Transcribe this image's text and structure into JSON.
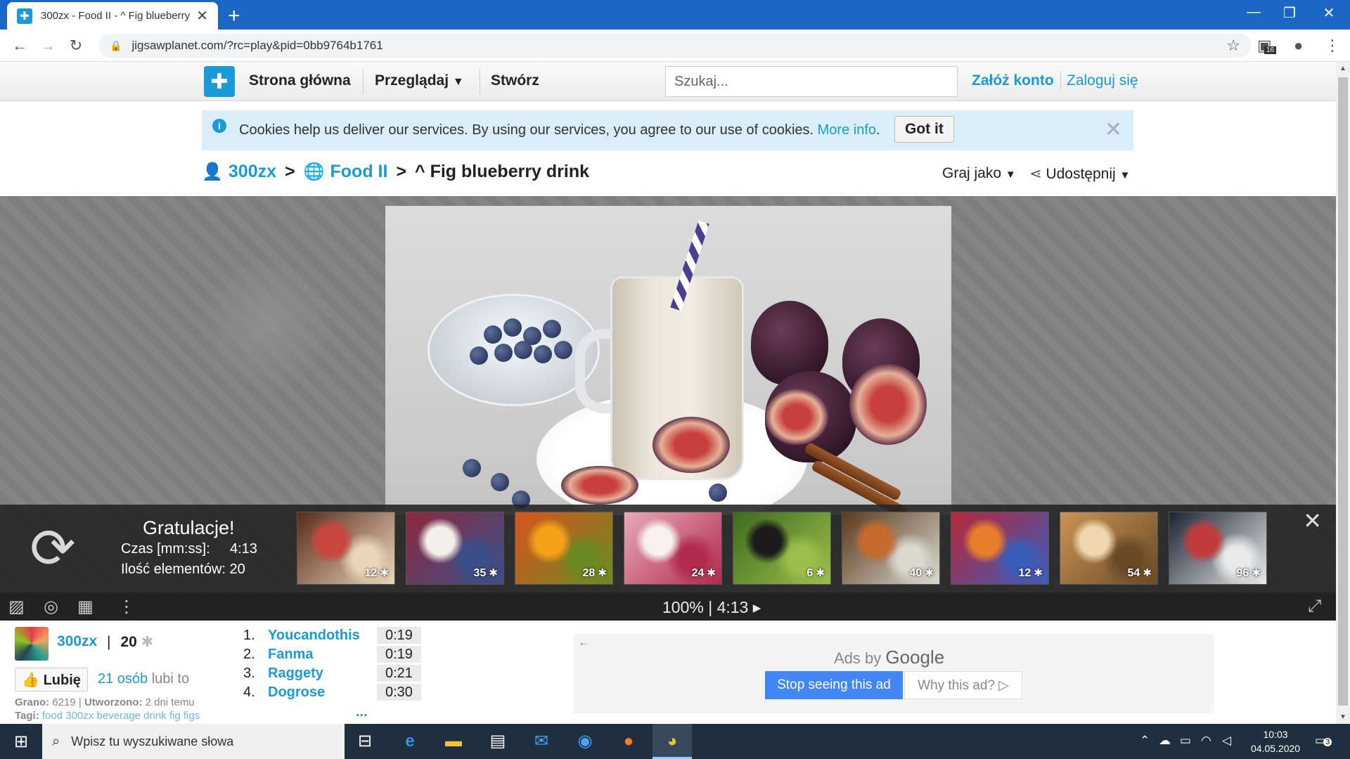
{
  "browser": {
    "tab_title": "300zx - Food II - ^ Fig blueberry",
    "url": "jigsawplanet.com/?rc=play&pid=0bb9764b1761",
    "extension_badge": "16"
  },
  "site": {
    "nav": {
      "home": "Strona główna",
      "browse": "Przeglądaj",
      "create": "Stwórz"
    },
    "search_placeholder": "Szukaj...",
    "register": "Załóż konto",
    "login": "Zaloguj się"
  },
  "cookie": {
    "message": "Cookies help us deliver our services. By using our services, you agree to our use of cookies.",
    "more_info": "More info",
    "got_it": "Got it"
  },
  "breadcrumb": {
    "user": "300zx",
    "sep1": ">",
    "folder": "Food II",
    "sep2": ">",
    "title": "^ Fig blueberry drink"
  },
  "menus": {
    "play_as": "Graj jako",
    "share": "Udostępnij"
  },
  "finish": {
    "congrats": "Gratulacje!",
    "time_label": "Czas [mm:ss]:",
    "time_value": "4:13",
    "pieces_label": "Ilość elementów:",
    "pieces_value": "20",
    "suggestions": [
      {
        "count": "12",
        "colors": [
          "#5a2a1c",
          "#c9463d",
          "#e9d6b8"
        ]
      },
      {
        "count": "35",
        "colors": [
          "#8c2a3e",
          "#f3f0ea",
          "#3a4f8a"
        ]
      },
      {
        "count": "28",
        "colors": [
          "#d9541d",
          "#f3a21a",
          "#6c8a23"
        ]
      },
      {
        "count": "24",
        "colors": [
          "#e7a9b7",
          "#f7f1f2",
          "#b12b4c"
        ]
      },
      {
        "count": "6",
        "colors": [
          "#3e6b1e",
          "#1b1b1b",
          "#9bbf4a"
        ]
      },
      {
        "count": "40",
        "colors": [
          "#5b3a1b",
          "#c76a2d",
          "#d9d9d0"
        ]
      },
      {
        "count": "12",
        "colors": [
          "#b8263a",
          "#e87d2c",
          "#3a5db8"
        ]
      },
      {
        "count": "54",
        "colors": [
          "#c99455",
          "#efd8b0",
          "#6a4a26"
        ]
      },
      {
        "count": "96",
        "colors": [
          "#1a2433",
          "#c23b3b",
          "#e9e9e9"
        ]
      }
    ]
  },
  "toolbar": {
    "status": "100%  |  4:13 ▸"
  },
  "info": {
    "user": "300zx",
    "separator": "|",
    "pieces": "20",
    "like_button": "Lubię",
    "likes_count": "21 osób",
    "likes_rest": "lubi to",
    "played_label": "Grano:",
    "played_value": "6219",
    "created_label": "Utworzono:",
    "created_value": "2 dni temu",
    "tags_label": "Tagi:",
    "tags": "food 300zx beverage drink fig figs"
  },
  "scores": [
    {
      "rank": "1.",
      "name": "Youcandothis",
      "time": "0:19"
    },
    {
      "rank": "2.",
      "name": "Fanma",
      "time": "0:19"
    },
    {
      "rank": "3.",
      "name": "Raggety",
      "time": "0:21"
    },
    {
      "rank": "4.",
      "name": "Dogrose",
      "time": "0:30"
    }
  ],
  "scores_more": "...",
  "ads": {
    "ads_by": "Ads by",
    "google": "Google",
    "stop": "Stop seeing this ad",
    "why": "Why this ad? ▷"
  },
  "taskbar": {
    "search_placeholder": "Wpisz tu wyszukiwane słowa",
    "time": "10:03",
    "date": "04.05.2020",
    "notifications": "3"
  }
}
